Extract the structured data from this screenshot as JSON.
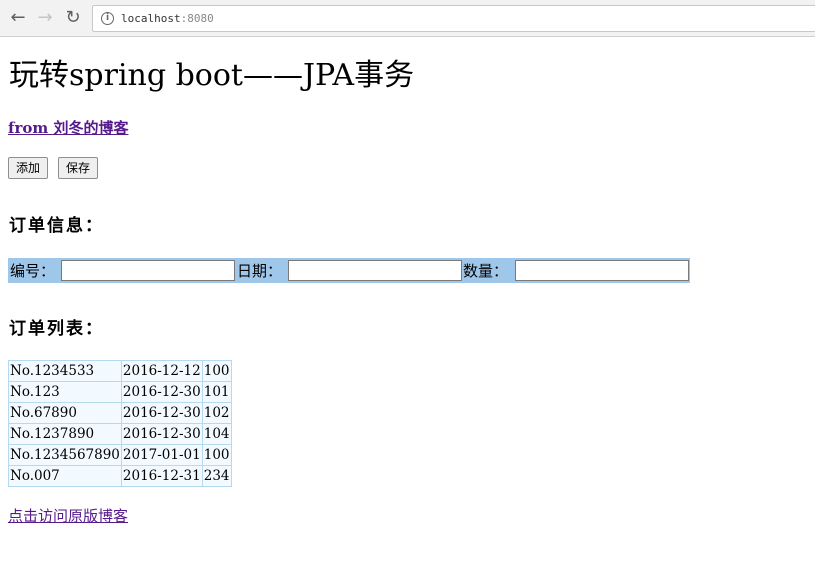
{
  "browser": {
    "url_host": "localhost",
    "url_port": ":8080",
    "back_icon": "arrow-left-icon",
    "forward_icon": "arrow-right-icon",
    "reload_icon": "reload-icon"
  },
  "page": {
    "title": "玩转spring boot——JPA事务",
    "author_link": "from 刘冬的博客",
    "buttons": {
      "add": "添加",
      "save": "保存"
    },
    "order_info_heading": "订单信息：",
    "form": {
      "number_label": "编号：",
      "date_label": "日期：",
      "quantity_label": "数量：",
      "number_value": "",
      "date_value": "",
      "quantity_value": ""
    },
    "order_list_heading": "订单列表：",
    "orders": [
      {
        "no": "No.1234533",
        "date": "2016-12-12",
        "qty": "100"
      },
      {
        "no": "No.123",
        "date": "2016-12-30",
        "qty": "101"
      },
      {
        "no": "No.67890",
        "date": "2016-12-30",
        "qty": "102"
      },
      {
        "no": "No.1237890",
        "date": "2016-12-30",
        "qty": "104"
      },
      {
        "no": "No.1234567890",
        "date": "2017-01-01",
        "qty": "100"
      },
      {
        "no": "No.007",
        "date": "2016-12-31",
        "qty": "234"
      }
    ],
    "blog_link": "点击访问原版博客"
  },
  "colors": {
    "form_bar": "#9fc7ea",
    "table_border": "#b5d9ef",
    "table_cell": "#f3faff",
    "visited_link": "#551a8b"
  }
}
